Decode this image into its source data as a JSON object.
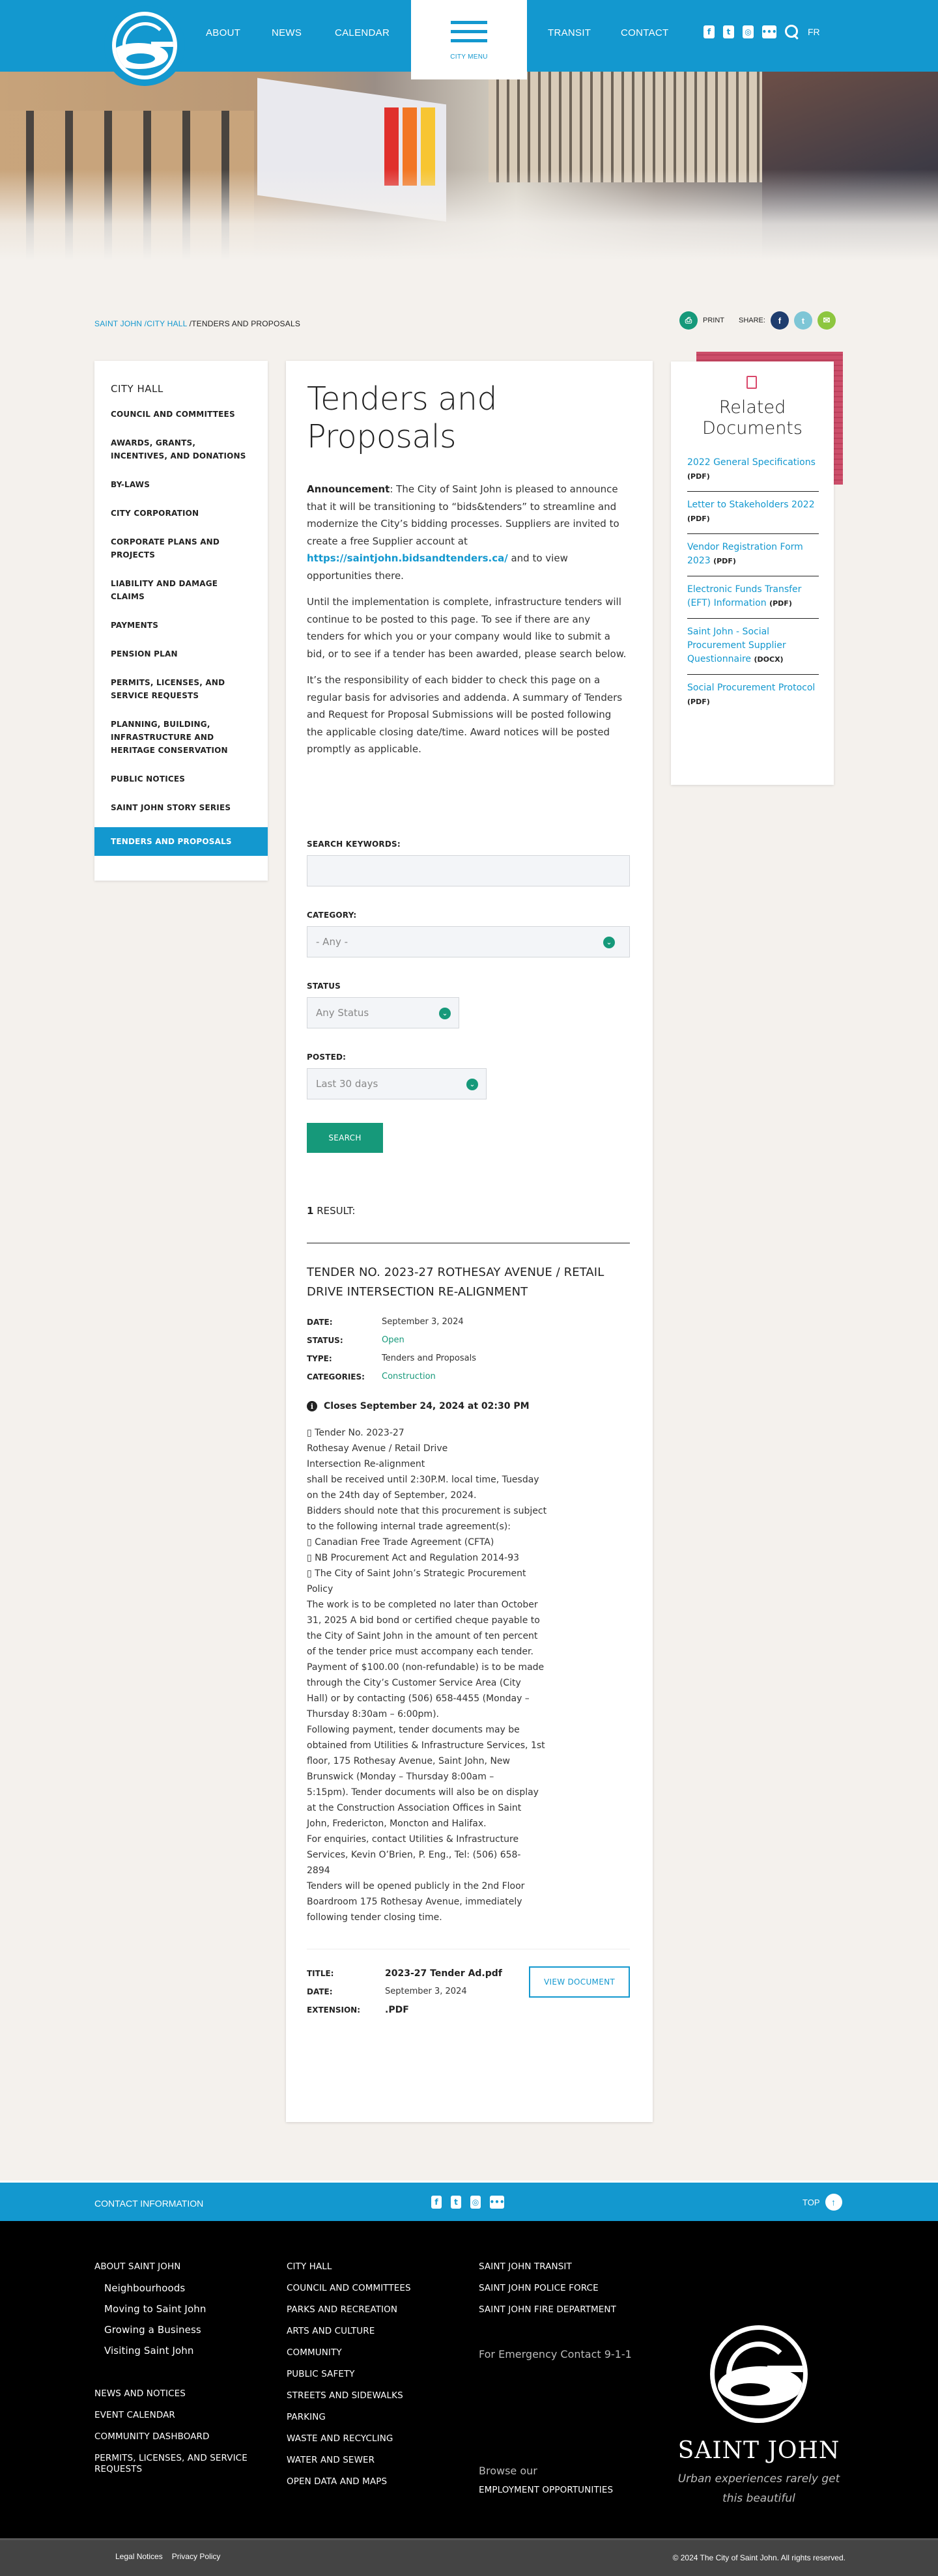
{
  "header": {
    "nav_left": [
      "ABOUT",
      "NEWS",
      "CALENDAR"
    ],
    "city_menu_label": "CITY MENU",
    "nav_right": [
      "TRANSIT",
      "CONTACT"
    ],
    "social": [
      "facebook-icon",
      "twitter-icon",
      "instagram-icon",
      "flickr-icon"
    ],
    "language": "FR"
  },
  "breadcrumb": {
    "items": [
      "SAINT JOHN",
      "/CITY HALL",
      "/TENDERS AND PROPOSALS"
    ]
  },
  "share": {
    "print_label": "PRINT",
    "share_label": "SHARE:"
  },
  "sidebar": {
    "title": "CITY HALL",
    "items": [
      "COUNCIL AND COMMITTEES",
      "AWARDS, GRANTS, INCENTIVES, AND DONATIONS",
      "BY-LAWS",
      "CITY CORPORATION",
      "CORPORATE PLANS AND PROJECTS",
      "LIABILITY AND DAMAGE CLAIMS",
      "PAYMENTS",
      "PENSION PLAN",
      "PERMITS, LICENSES, AND SERVICE REQUESTS",
      "PLANNING, BUILDING, INFRASTRUCTURE AND HERITAGE CONSERVATION",
      "PUBLIC NOTICES",
      "SAINT JOHN STORY SERIES",
      "TENDERS AND PROPOSALS"
    ],
    "active_index": 12
  },
  "main": {
    "title": "Tenders and Proposals",
    "announcement_label": "Announcement",
    "announcement_text": ": The City of Saint John is pleased to announce that it will be transitioning to “bids&tenders” to streamline and modernize the City’s bidding processes. Suppliers are invited to create a free Supplier account at ",
    "announcement_link": "https://saintjohn.bidsandtenders.ca/",
    "announcement_tail": " and to view opportunities there.",
    "paragraph2": "Until the implementation is complete, infrastructure tenders will continue to be posted to this page. To see if there are any tenders for which you or your company would like to submit a bid, or to see if a tender has been awarded, please search below.",
    "paragraph3": "It’s the responsibility of each bidder to check this page on a regular basis for advisories and addenda. A summary of Tenders and Request for Proposal Submissions will be posted following the applicable closing date/time. Award notices will be posted promptly as applicable."
  },
  "search_form": {
    "keywords_label": "SEARCH KEYWORDS:",
    "keywords_value": "",
    "category_label": "CATEGORY:",
    "category_value": "- Any -",
    "status_label": "STATUS",
    "status_value": "Any Status",
    "posted_label": "POSTED:",
    "posted_value": "Last 30 days",
    "search_button": "SEARCH"
  },
  "results": {
    "count": "1",
    "count_label": " RESULT:",
    "tender": {
      "title": "TENDER NO. 2023-27 ROTHESAY AVENUE / RETAIL DRIVE INTERSECTION RE-ALIGNMENT",
      "meta": [
        {
          "key": "DATE:",
          "value": "September 3, 2024"
        },
        {
          "key": "STATUS:",
          "value": "Open"
        },
        {
          "key": "TYPE:",
          "value": "Tenders and Proposals"
        },
        {
          "key": "CATEGORIES:",
          "value": "Construction"
        }
      ],
      "closes": "Closes September 24, 2024 at 02:30 PM",
      "body_lines": [
        "▯ Tender No. 2023-27",
        "Rothesay Avenue / Retail Drive",
        "Intersection Re-alignment",
        "shall be received until 2:30P.M. local time, Tuesday",
        "on the 24th day of September, 2024.",
        "Bidders should note that this procurement is subject",
        "to the following internal trade agreement(s):",
        "▯ Canadian Free Trade Agreement (CFTA)",
        "▯ NB Procurement Act and Regulation 2014-93",
        "▯ The City of Saint John’s Strategic Procurement",
        "Policy",
        "The work is to be completed no later than October",
        "31, 2025 A bid bond or certified cheque payable to",
        "the City of Saint John in the amount of ten percent",
        "of the tender price must accompany each tender.",
        "Payment of $100.00 (non-refundable) is to be made",
        "through the City’s Customer Service Area (City",
        "Hall) or by contacting (506) 658-4455 (Monday –",
        "Thursday 8:30am – 6:00pm).",
        "Following payment, tender documents may be",
        "obtained from Utilities & Infrastructure Services, 1st",
        "floor, 175 Rothesay Avenue, Saint John, New",
        "Brunswick (Monday – Thursday 8:00am –",
        "5:15pm). Tender documents will also be on display",
        "at the Construction Association Offices in Saint",
        "John, Fredericton, Moncton and Halifax.",
        "For enquiries, contact Utilities & Infrastructure",
        "Services, Kevin O’Brien, P. Eng., Tel: (506) 658-",
        "2894",
        "Tenders will be opened publicly in the 2nd Floor",
        "Boardroom 175 Rothesay Avenue, immediately",
        "following tender closing time."
      ],
      "document": {
        "title_key": "TITLE:",
        "title": "2023-27 Tender Ad.pdf",
        "date_key": "DATE:",
        "date": "September 3, 2024",
        "ext_key": "EXTENSION:",
        "extension": ".PDF",
        "view_button": "VIEW DOCUMENT"
      }
    }
  },
  "related_documents": {
    "title": "Related Documents",
    "items": [
      {
        "label": "2022 General Specifications",
        "ext": "(PDF)"
      },
      {
        "label": "Letter to Stakeholders 2022",
        "ext": "(PDF)"
      },
      {
        "label": "Vendor Registration Form 2023",
        "ext": "(PDF)"
      },
      {
        "label": "Electronic Funds Transfer (EFT) Information",
        "ext": "(PDF)"
      },
      {
        "label": "Saint John - Social Procurement Supplier Questionnaire",
        "ext": "(DOCX)"
      },
      {
        "label": "Social Procurement Protocol",
        "ext": "(PDF)"
      }
    ]
  },
  "footer": {
    "contact_label": "CONTACT INFORMATION",
    "top_label": "TOP",
    "col1": {
      "heading": "ABOUT SAINT JOHN",
      "sub": [
        "Neighbourhoods",
        "Moving to Saint John",
        "Growing a Business",
        "Visiting Saint John"
      ],
      "links": [
        "NEWS AND NOTICES",
        "EVENT CALENDAR",
        "COMMUNITY DASHBOARD",
        "PERMITS, LICENSES, AND SERVICE REQUESTS"
      ]
    },
    "col2": [
      "CITY HALL",
      "COUNCIL AND COMMITTEES",
      "PARKS AND RECREATION",
      "ARTS AND CULTURE",
      "COMMUNITY",
      "PUBLIC SAFETY",
      "STREETS AND SIDEWALKS",
      "PARKING",
      "WASTE AND RECYCLING",
      "WATER AND SEWER",
      "OPEN DATA AND MAPS"
    ],
    "col3": [
      "SAINT JOHN TRANSIT",
      "SAINT JOHN POLICE FORCE",
      "SAINT JOHN FIRE DEPARTMENT"
    ],
    "emergency": "For Emergency Contact 9-1-1",
    "browse": "Browse our",
    "employment": "EMPLOYMENT OPPORTUNITIES",
    "brand_name": "SAINT JOHN",
    "tagline": "Urban experiences rarely get this beautiful",
    "legal": "Legal Notices",
    "privacy": "Privacy Policy",
    "copyright": "© 2024 The City of Saint John. All rights reserved."
  },
  "colors": {
    "brand_blue": "#1398cf",
    "action_green": "#16997a",
    "accent_red": "#c9405f"
  }
}
